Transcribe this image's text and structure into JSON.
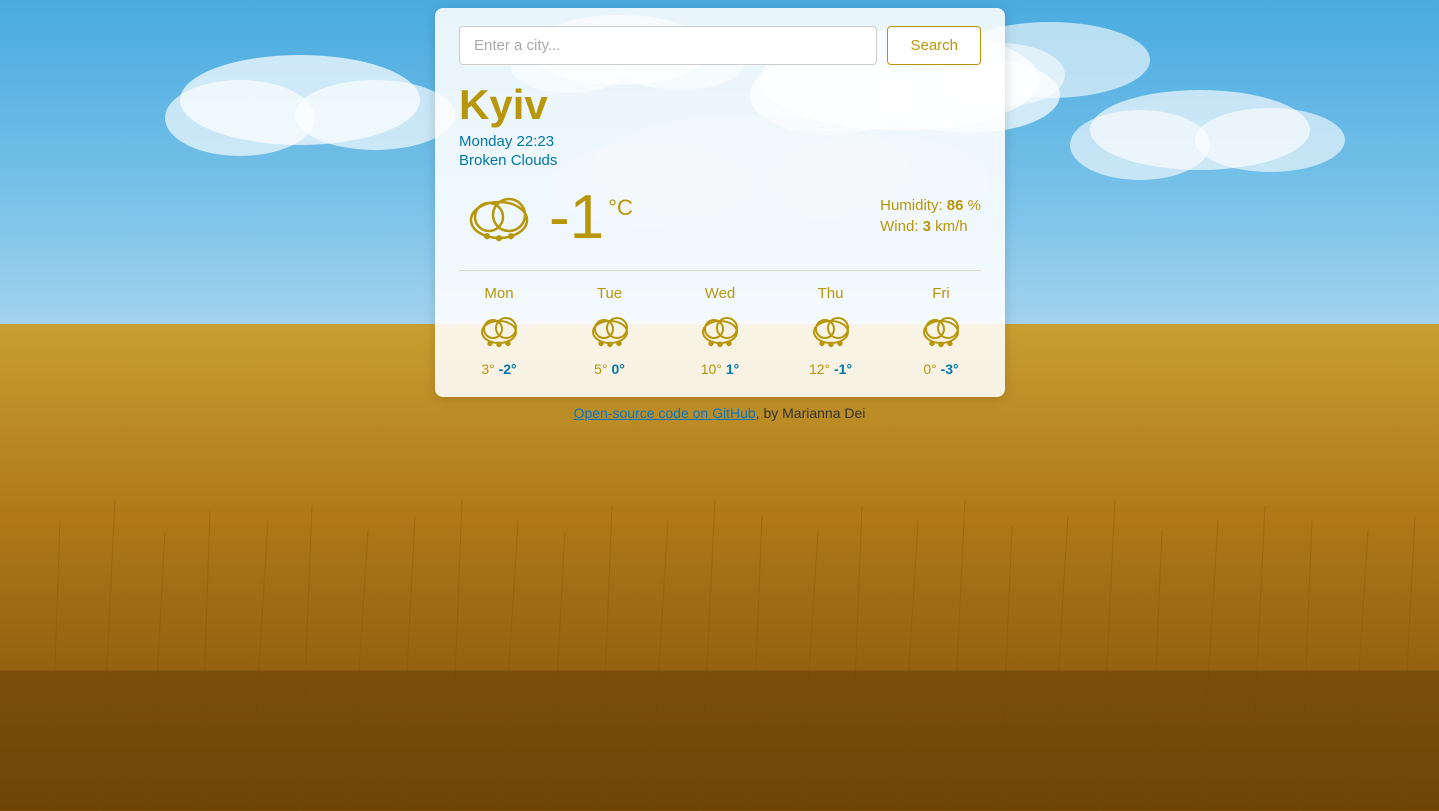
{
  "background": {
    "description": "wheat field with blue sky background"
  },
  "search": {
    "placeholder": "Enter a city...",
    "button_label": "Search",
    "current_value": ""
  },
  "current_weather": {
    "city": "Kyiv",
    "datetime": "Monday 22:23",
    "condition": "Broken Clouds",
    "temperature": "-1",
    "unit": "°C",
    "humidity_label": "Humidity:",
    "humidity_value": "86",
    "humidity_unit": "%",
    "wind_label": "Wind:",
    "wind_value": "3",
    "wind_unit": "km/h"
  },
  "forecast": [
    {
      "day": "Mon",
      "high": "3°",
      "low": "-2°",
      "condition": "broken clouds"
    },
    {
      "day": "Tue",
      "high": "5°",
      "low": "0°",
      "condition": "broken clouds"
    },
    {
      "day": "Wed",
      "high": "10°",
      "low": "1°",
      "condition": "broken clouds"
    },
    {
      "day": "Thu",
      "high": "12°",
      "low": "-1°",
      "condition": "broken clouds"
    },
    {
      "day": "Fri",
      "high": "0°",
      "low": "-3°",
      "condition": "broken clouds"
    }
  ],
  "footer": {
    "github_link_text": "Open-source code on GitHub",
    "author_text": ", by Marianna Dei"
  }
}
